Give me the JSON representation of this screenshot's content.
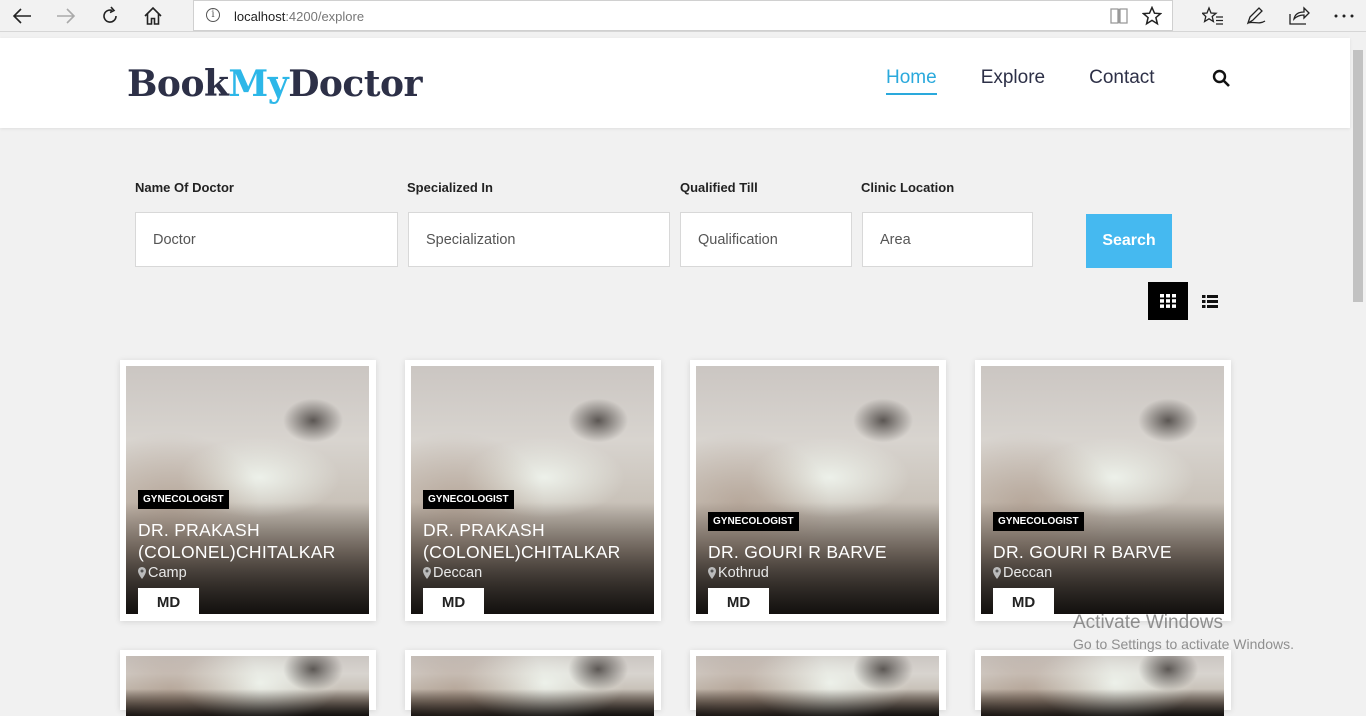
{
  "browser": {
    "url_host": "localhost",
    "url_path": ":4200/explore"
  },
  "header": {
    "logo_part1": "Book",
    "logo_part2": "My",
    "logo_part3": "Doctor",
    "nav": [
      {
        "label": "Home",
        "active": true
      },
      {
        "label": "Explore",
        "active": false
      },
      {
        "label": "Contact",
        "active": false
      }
    ]
  },
  "filters": {
    "doctor_label": "Name Of Doctor",
    "doctor_placeholder": "Doctor",
    "specialization_label": "Specialized In",
    "specialization_placeholder": "Specialization",
    "qualification_label": "Qualified Till",
    "qualification_placeholder": "Qualification",
    "location_label": "Clinic Location",
    "location_placeholder": "Area",
    "search_label": "Search"
  },
  "doctors": [
    {
      "specialty": "GYNECOLOGIST",
      "name": "DR. PRAKASH (COLONEL)CHITALKAR",
      "location": "Camp",
      "degree": "MD"
    },
    {
      "specialty": "GYNECOLOGIST",
      "name": "DR. PRAKASH (COLONEL)CHITALKAR",
      "location": "Deccan",
      "degree": "MD"
    },
    {
      "specialty": "GYNECOLOGIST",
      "name": "DR. GOURI R BARVE",
      "location": "Kothrud",
      "degree": "MD"
    },
    {
      "specialty": "GYNECOLOGIST",
      "name": "DR. GOURI R BARVE",
      "location": "Deccan",
      "degree": "MD"
    }
  ],
  "watermark": {
    "title": "Activate Windows",
    "subtitle": "Go to Settings to activate Windows."
  },
  "colors": {
    "brand_dark": "#2d3047",
    "brand_accent": "#2db7e8",
    "search_button": "#45b9f0"
  }
}
